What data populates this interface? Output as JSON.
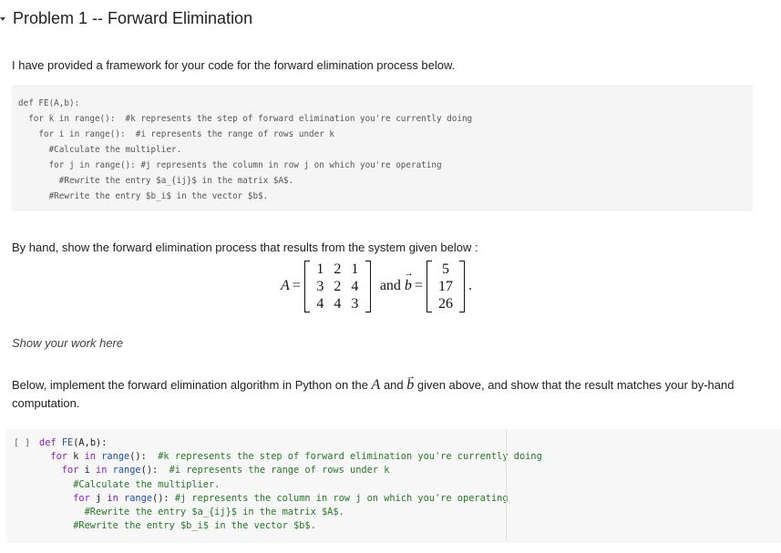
{
  "section": {
    "title": "Problem 1 -- Forward Elimination",
    "collapse_icon": "caret-down-icon"
  },
  "intro_text": "I have provided a framework for your code for the forward elimination process below.",
  "markdown_code": {
    "lines": [
      "def FE(A,b):",
      "  for k in range():  #k represents the step of forward elimination you're currently doing",
      "    for i in range():  #i represents the range of rows under k",
      "      #Calculate the multiplier.",
      "      for j in range(): #j represents the column in row j on which you're operating",
      "        #Rewrite the entry $a_{ij}$ in the matrix $A$.",
      "      #Rewrite the entry $b_i$ in the vector $b$."
    ]
  },
  "byhand_text": "By hand, show the forward elimination process that results from the system given below :",
  "math": {
    "A_label": "A",
    "equals": "=",
    "and_text": "and",
    "b_label": "b",
    "period": ".",
    "matrix_A": [
      [
        "1",
        "2",
        "1"
      ],
      [
        "3",
        "2",
        "4"
      ],
      [
        "4",
        "4",
        "3"
      ]
    ],
    "vector_b": [
      "5",
      "17",
      "26"
    ]
  },
  "show_work_text": "Show your work here",
  "below_text": {
    "part1": "Below, implement the forward elimination algorithm in Python on the ",
    "A": "A",
    "part2": " and ",
    "b": "b",
    "part3": " given above, and show that the result matches your by-hand computation."
  },
  "code_cell": {
    "run_indicator": "[ ]",
    "lines": [
      [
        {
          "t": "def ",
          "c": "kw"
        },
        {
          "t": "FE",
          "c": "fn"
        },
        {
          "t": "(A,b):",
          "c": ""
        }
      ],
      [
        {
          "t": "  for ",
          "c": "kw"
        },
        {
          "t": "k ",
          "c": ""
        },
        {
          "t": "in ",
          "c": "kw"
        },
        {
          "t": "range",
          "c": "fn"
        },
        {
          "t": "():  ",
          "c": ""
        },
        {
          "t": "#k represents the step of forward elimination you're currently doing",
          "c": "cm"
        }
      ],
      [
        {
          "t": "    for ",
          "c": "kw"
        },
        {
          "t": "i ",
          "c": ""
        },
        {
          "t": "in ",
          "c": "kw"
        },
        {
          "t": "range",
          "c": "fn"
        },
        {
          "t": "():  ",
          "c": ""
        },
        {
          "t": "#i represents the range of rows under k",
          "c": "cm"
        }
      ],
      [
        {
          "t": "      #Calculate the multiplier.",
          "c": "cm"
        }
      ],
      [
        {
          "t": "      for ",
          "c": "kw"
        },
        {
          "t": "j ",
          "c": ""
        },
        {
          "t": "in ",
          "c": "kw"
        },
        {
          "t": "range",
          "c": "fn"
        },
        {
          "t": "(): ",
          "c": ""
        },
        {
          "t": "#j represents the column in row j on which you're operating",
          "c": "cm"
        }
      ],
      [
        {
          "t": "        #Rewrite the entry $a_{ij}$ in the matrix $A$.",
          "c": "cm"
        }
      ],
      [
        {
          "t": "      #Rewrite the entry $b_i$ in the vector $b$.",
          "c": "cm"
        }
      ]
    ]
  }
}
